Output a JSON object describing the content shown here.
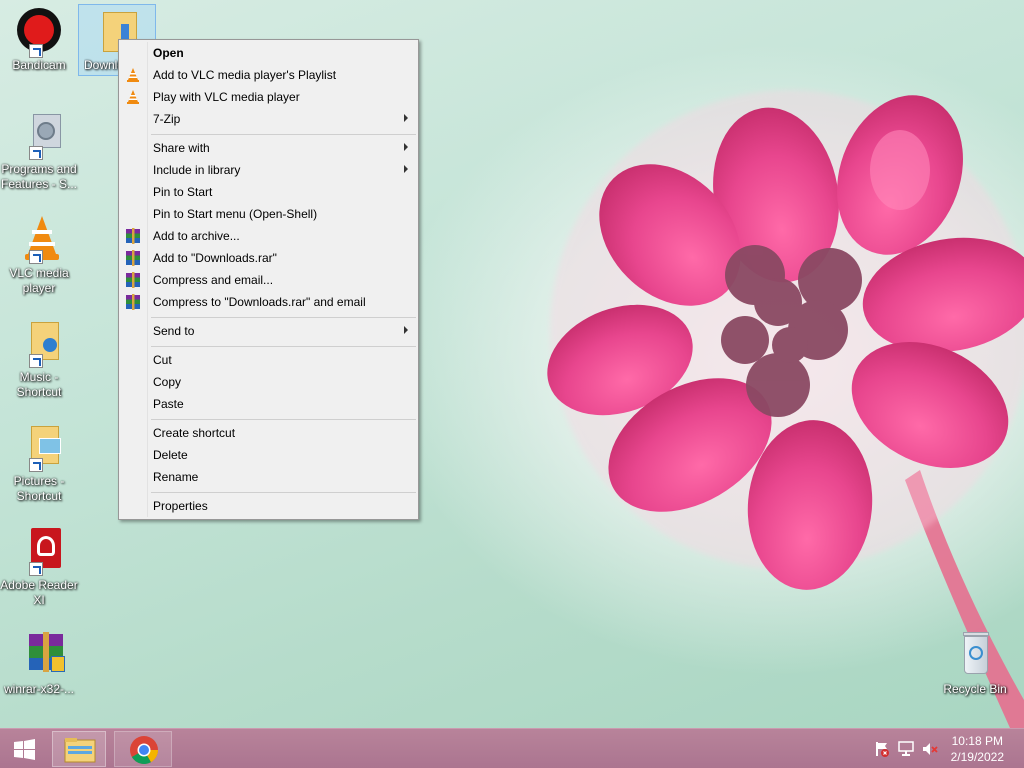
{
  "desktop_icons": [
    {
      "label": "Bandicam",
      "icon": "bandicam-icon"
    },
    {
      "label": "Downloads",
      "icon": "downloads-folder-icon"
    },
    {
      "label": "Programs and Features - S...",
      "icon": "programs-features-icon"
    },
    {
      "label": "VLC media player",
      "icon": "vlc-cone-icon"
    },
    {
      "label": "Music - Shortcut",
      "icon": "music-folder-icon"
    },
    {
      "label": "Pictures - Shortcut",
      "icon": "pictures-folder-icon"
    },
    {
      "label": "Adobe Reader XI",
      "icon": "adobe-reader-icon"
    },
    {
      "label": "winrar-x32-...",
      "icon": "winrar-icon"
    },
    {
      "label": "Recycle Bin",
      "icon": "recycle-bin-icon"
    }
  ],
  "context_menu": {
    "items": [
      {
        "label": "Open",
        "bold": true
      },
      {
        "label": "Add to VLC media player's Playlist",
        "icon": "vlc-cone-icon"
      },
      {
        "label": "Play with VLC media player",
        "icon": "vlc-cone-icon"
      },
      {
        "label": "7-Zip",
        "submenu": true
      },
      {
        "label": "Share with",
        "submenu": true
      },
      {
        "label": "Include in library",
        "submenu": true
      },
      {
        "label": "Pin to Start"
      },
      {
        "label": "Pin to Start menu (Open-Shell)"
      },
      {
        "label": "Add to archive...",
        "icon": "winrar-icon"
      },
      {
        "label": "Add to \"Downloads.rar\"",
        "icon": "winrar-icon"
      },
      {
        "label": "Compress and email...",
        "icon": "winrar-icon"
      },
      {
        "label": "Compress to \"Downloads.rar\" and email",
        "icon": "winrar-icon"
      },
      {
        "label": "Send to",
        "submenu": true
      },
      {
        "label": "Cut"
      },
      {
        "label": "Copy"
      },
      {
        "label": "Paste"
      },
      {
        "label": "Create shortcut"
      },
      {
        "label": "Delete"
      },
      {
        "label": "Rename"
      },
      {
        "label": "Properties"
      }
    ]
  },
  "taskbar": {
    "start": "windows-start-icon",
    "pinned": [
      "file-explorer-icon",
      "chrome-icon"
    ],
    "tray": [
      "action-center-flag-icon",
      "network-icon",
      "volume-muted-icon"
    ],
    "time": "10:18 PM",
    "date": "2/19/2022"
  },
  "colors": {
    "taskbar": "#ab7590",
    "menu_bg": "#f0f0f0",
    "flower": "#e8468e"
  }
}
